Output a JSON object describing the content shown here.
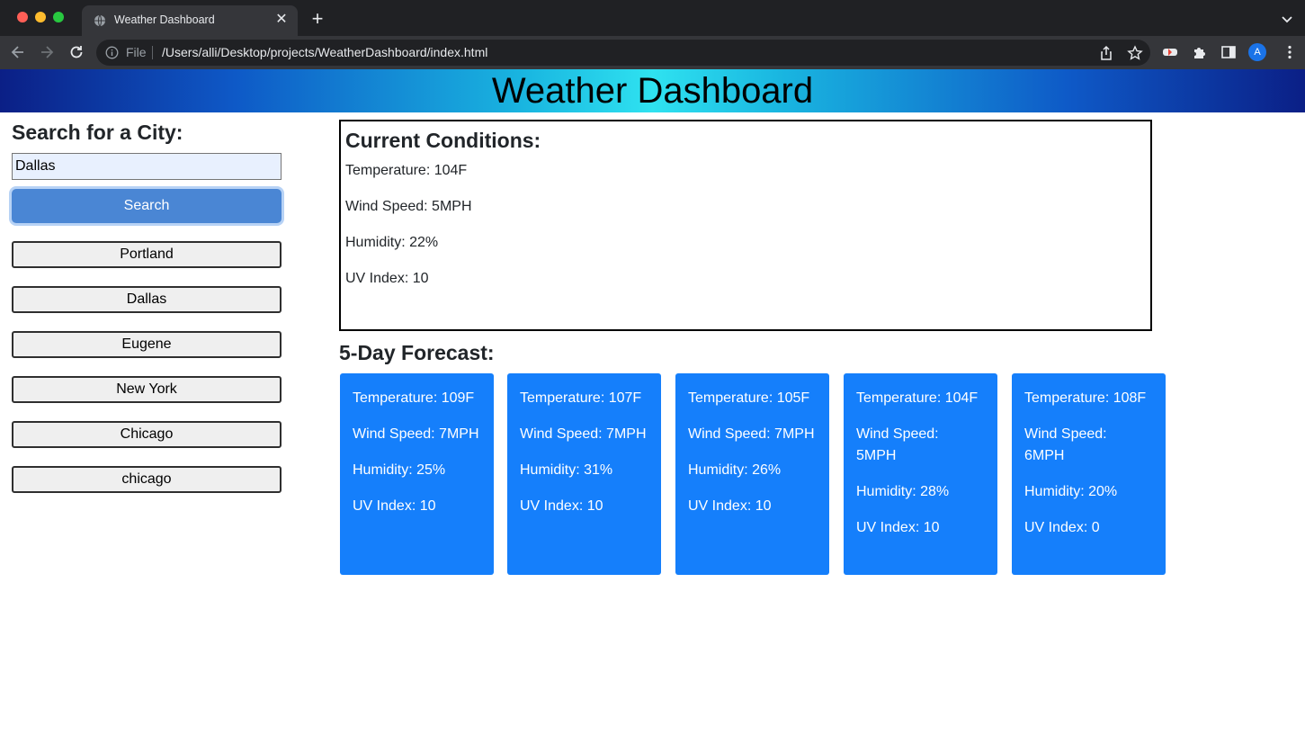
{
  "browser": {
    "tab_title": "Weather Dashboard",
    "url_scheme": "File",
    "url": "/Users/alli/Desktop/projects/WeatherDashboard/index.html",
    "avatar_letter": "A"
  },
  "page": {
    "title": "Weather Dashboard"
  },
  "search": {
    "heading": "Search for a City:",
    "input_value": "Dallas",
    "button_label": "Search"
  },
  "history": [
    "Portland",
    "Dallas",
    "Eugene",
    "New York",
    "Chicago",
    "chicago"
  ],
  "current": {
    "heading": "Current Conditions:",
    "temperature": "Temperature: 104F",
    "wind": "Wind Speed: 5MPH",
    "humidity": "Humidity: 22%",
    "uv": "UV Index: 10"
  },
  "forecast": {
    "heading": "5-Day Forecast:",
    "days": [
      {
        "temperature": "Temperature: 109F",
        "wind": "Wind Speed: 7MPH",
        "humidity": "Humidity: 25%",
        "uv": "UV Index: 10"
      },
      {
        "temperature": "Temperature: 107F",
        "wind": "Wind Speed: 7MPH",
        "humidity": "Humidity: 31%",
        "uv": "UV Index: 10"
      },
      {
        "temperature": "Temperature: 105F",
        "wind": "Wind Speed: 7MPH",
        "humidity": "Humidity: 26%",
        "uv": "UV Index: 10"
      },
      {
        "temperature": "Temperature: 104F",
        "wind": "Wind Speed: 5MPH",
        "humidity": "Humidity: 28%",
        "uv": "UV Index: 10"
      },
      {
        "temperature": "Temperature: 108F",
        "wind": "Wind Speed: 6MPH",
        "humidity": "Humidity: 20%",
        "uv": "UV Index: 0"
      }
    ]
  },
  "colors": {
    "card_blue": "#157ffb",
    "search_button": "#4a86d4"
  }
}
